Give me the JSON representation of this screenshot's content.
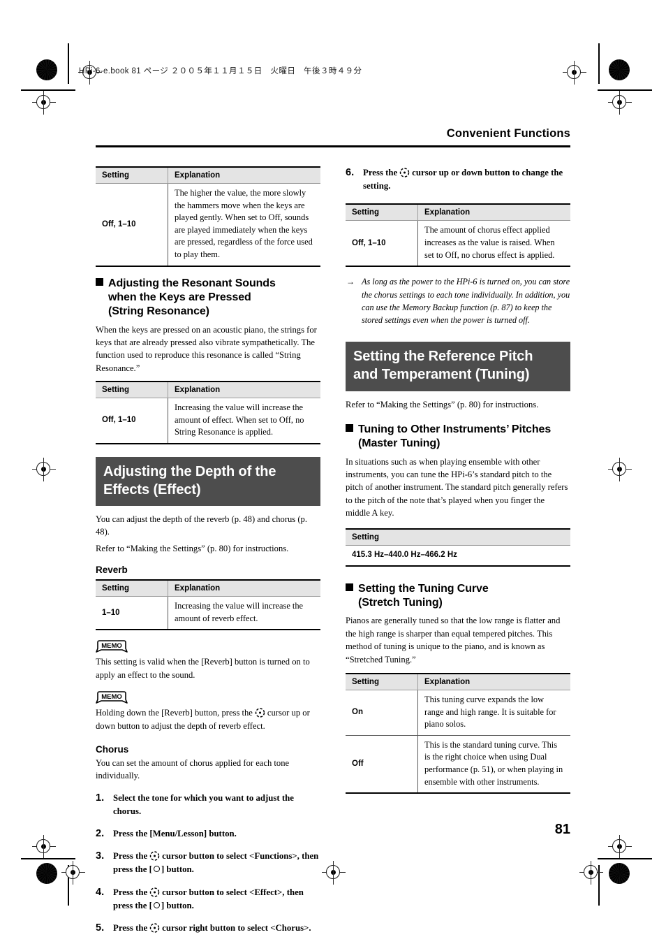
{
  "page": {
    "slug": "HPi-6-e.book 81 ページ ２００５年１１月１５日　火曜日　午後３時４９分",
    "running_head": "Convenient Functions",
    "folio": "81",
    "banner_bg": "#4d4d4d",
    "table_header_bg": "#e4e4e4"
  },
  "left_column": {
    "table_key_touch": {
      "headers": [
        "Setting",
        "Explanation"
      ],
      "rows": [
        {
          "setting": "Off, 1–10",
          "explanation": "The higher the value, the more slowly the hammers move when the keys are played gently. When set to Off, sounds are played immediately when the keys are pressed, regardless of the force used to play them."
        }
      ]
    },
    "heading_string_resonance": {
      "line1": "Adjusting the Resonant Sounds",
      "line2": "when the Keys are Pressed",
      "line3": "(String Resonance)"
    },
    "string_resonance_body": "When the keys are pressed on an acoustic piano, the strings for keys that are already pressed also vibrate sympathetically. The function used to reproduce this resonance is called “String Resonance.”",
    "table_string_resonance": {
      "headers": [
        "Setting",
        "Explanation"
      ],
      "rows": [
        {
          "setting": "Off, 1–10",
          "explanation": "Increasing the value will increase the amount of effect. When set to Off, no String Resonance is applied."
        }
      ]
    },
    "banner_effect": {
      "line1": "Adjusting the Depth of the",
      "line2": "Effects (Effect)"
    },
    "effect_body_1": "You can adjust the depth of the reverb (p. 48) and chorus (p. 48).",
    "effect_body_2": "Refer to “Making the Settings” (p. 80) for instructions.",
    "subheading_reverb": "Reverb",
    "table_reverb": {
      "headers": [
        "Setting",
        "Explanation"
      ],
      "rows": [
        {
          "setting": "1–10",
          "explanation": "Increasing the value will increase the amount of reverb effect."
        }
      ]
    },
    "memo_1": {
      "badge": "MEMO",
      "text": "This setting is valid when the [Reverb] button is turned on to apply an effect to the sound."
    },
    "memo_2": {
      "badge": "MEMO",
      "text_before": "Holding down the [Reverb] button, press the",
      "text_after": "cursor up or down button to adjust the depth of reverb effect."
    },
    "subheading_chorus": "Chorus",
    "chorus_body": "You can set the amount of chorus applied for each tone individually.",
    "steps": [
      {
        "num": "1.",
        "text": "Select the tone for which you want to adjust the chorus."
      },
      {
        "num": "2.",
        "text": "Press the [Menu/Lesson] button."
      },
      {
        "num": "3.",
        "part1": "Press the",
        "part2": "cursor button to select <Functions>, then press the [",
        "part3": "] button."
      },
      {
        "num": "4.",
        "part1": "Press the",
        "part2": "cursor button to select <Effect>, then press the [",
        "part3": "] button."
      },
      {
        "num": "5.",
        "part1": "Press the",
        "part2": "cursor right button to select <Chorus>.",
        "part3": ""
      }
    ]
  },
  "right_column": {
    "step_6": {
      "num": "6.",
      "part1": "Press the",
      "part2": "cursor up or down button to change the setting."
    },
    "table_chorus": {
      "headers": [
        "Setting",
        "Explanation"
      ],
      "rows": [
        {
          "setting": "Off, 1–10",
          "explanation": "The amount of chorus effect applied increases as the value is raised. When set to Off, no chorus effect is applied."
        }
      ]
    },
    "note": "As long as the power to the HPi-6 is turned on, you can store the chorus settings to each tone individually. In addition, you can use the Memory Backup function (p. 87) to keep the stored settings even when the power is turned off.",
    "banner_tuning": {
      "line1": "Setting the Reference Pitch",
      "line2": "and Temperament (Tuning)"
    },
    "tuning_body": "Refer to “Making the Settings” (p. 80) for instructions.",
    "heading_master_tuning": {
      "line1": "Tuning to Other Instruments’ Pitches",
      "line2": "(Master Tuning)"
    },
    "master_tuning_body": "In situations such as when playing ensemble with other instruments, you can tune the HPi-6’s standard pitch to the pitch of another instrument. The standard pitch generally refers to the pitch of the note that’s played when you finger the middle A key.",
    "table_master_tuning": {
      "headers": [
        "Setting"
      ],
      "rows": [
        {
          "setting": "415.3 Hz–440.0 Hz–466.2 Hz"
        }
      ]
    },
    "heading_stretch_tuning": {
      "line1": "Setting the Tuning Curve",
      "line2": "(Stretch Tuning)"
    },
    "stretch_tuning_body": "Pianos are generally tuned so that the low range is flatter and the high range is sharper than equal tempered pitches. This method of tuning is unique to the piano, and is known as “Stretched Tuning.”",
    "table_stretch_tuning": {
      "headers": [
        "Setting",
        "Explanation"
      ],
      "rows": [
        {
          "setting": "On",
          "explanation": "This tuning curve expands the low range and high range. It is suitable for piano solos."
        },
        {
          "setting": "Off",
          "explanation": "This is the standard tuning curve. This is the right choice when using Dual performance (p. 51), or when playing in ensemble with other instruments."
        }
      ]
    }
  }
}
